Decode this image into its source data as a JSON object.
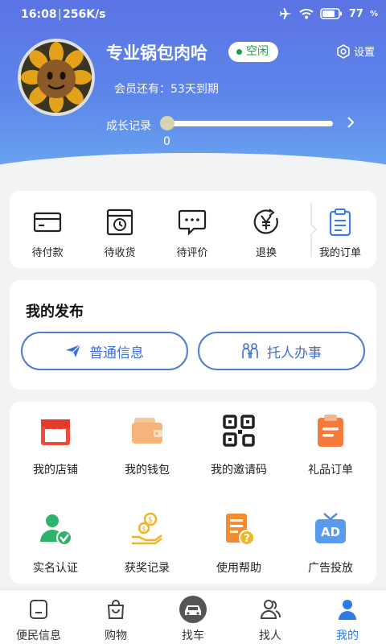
{
  "statusbar": {
    "time": "16:08",
    "separator": "|",
    "speed": "256K/s",
    "battery": "77"
  },
  "profile": {
    "username": "专业锅包肉哈",
    "status": "空闲",
    "settings_label": "设置",
    "membership": "会员还有：53天到期",
    "growth_label": "成长记录",
    "growth_value": "0"
  },
  "orders": [
    {
      "label": "待付款",
      "icon": "card-icon"
    },
    {
      "label": "待收货",
      "icon": "package-icon"
    },
    {
      "label": "待评价",
      "icon": "chat-icon"
    },
    {
      "label": "退换",
      "icon": "yen-return-icon"
    },
    {
      "label": "我的订单",
      "icon": "clipboard-icon"
    }
  ],
  "publish": {
    "title": "我的发布",
    "buttons": [
      {
        "label": "普通信息",
        "icon": "paper-plane-icon"
      },
      {
        "label": "托人办事",
        "icon": "people-icon"
      }
    ]
  },
  "services": [
    {
      "label": "我的店铺",
      "icon": "shop-icon"
    },
    {
      "label": "我的钱包",
      "icon": "wallet-icon"
    },
    {
      "label": "我的邀请码",
      "icon": "qr-code-icon"
    },
    {
      "label": "礼品订单",
      "icon": "gift-order-icon"
    },
    {
      "label": "实名认证",
      "icon": "verified-user-icon"
    },
    {
      "label": "获奖记录",
      "icon": "prize-icon"
    },
    {
      "label": "使用帮助",
      "icon": "help-doc-icon"
    },
    {
      "label": "广告投放",
      "icon": "ad-tv-icon"
    }
  ],
  "tabs": [
    {
      "label": "便民信息",
      "icon": "info-icon"
    },
    {
      "label": "购物",
      "icon": "shopping-bag-icon"
    },
    {
      "label": "找车",
      "icon": "car-icon"
    },
    {
      "label": "找人",
      "icon": "person-icon"
    },
    {
      "label": "我的",
      "icon": "me-icon",
      "active": true
    }
  ],
  "colors": {
    "accent": "#2d7be5",
    "header": "#5b73e4",
    "online": "#18a34a"
  }
}
